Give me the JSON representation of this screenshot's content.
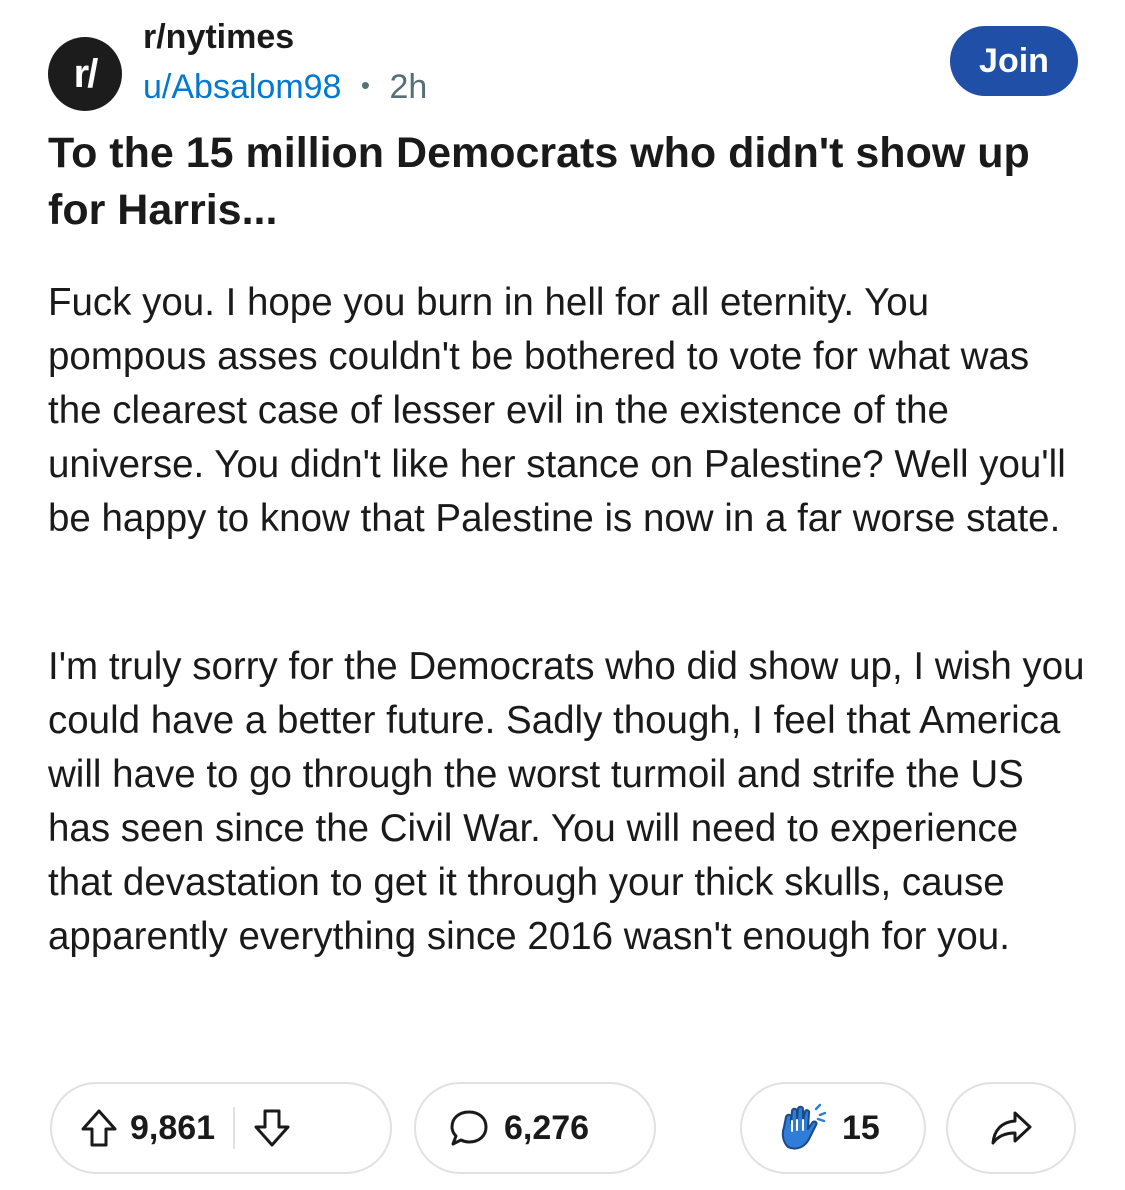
{
  "post": {
    "subreddit": "r/nytimes",
    "subreddit_icon_text": "r/",
    "author": "u/Absalom98",
    "separator": "•",
    "time": "2h",
    "join_label": "Join",
    "title": "To the 15 million Democrats who didn't show up for Harris...",
    "body": [
      "Fuck you. I hope you burn in hell for all eternity. You pompous asses couldn't be bothered to vote for what was the clearest case of lesser evil in the existence of the universe. You didn't like her stance on Palestine? Well you'll be happy to know that Palestine is now in a far worse state.",
      "I'm truly sorry for the Democrats who did show up, I wish you could have a better future. Sadly though, I feel that America will have to go through the worst turmoil and strife the US has seen since the Civil War. You will need to experience that devastation to get it through your thick skulls, cause apparently everything since 2016 wasn't enough for you."
    ]
  },
  "actions": {
    "upvotes": "9,861",
    "comments": "6,276",
    "awards": "15",
    "icons": {
      "upvote": "upvote-arrow-icon",
      "downvote": "downvote-arrow-icon",
      "comment": "comment-bubble-icon",
      "award": "clapping-hands-icon",
      "share": "share-arrow-icon"
    }
  },
  "colors": {
    "join_button": "#1f4fa6",
    "author_link": "#0079d3",
    "pill_border": "#dfe1e3",
    "award_blue": "#2f7dd8"
  }
}
